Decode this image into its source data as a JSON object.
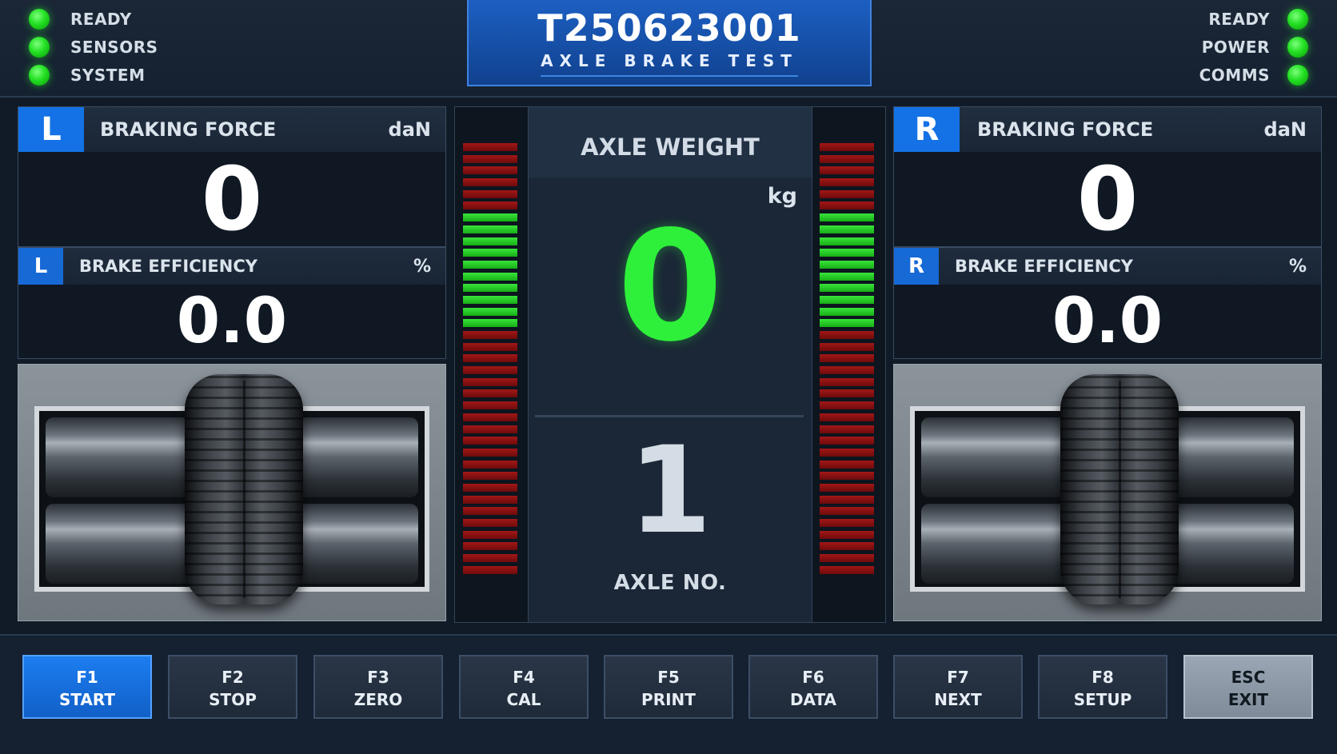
{
  "header": {
    "status_left": [
      {
        "label": "READY",
        "state": "on"
      },
      {
        "label": "SENSORS",
        "state": "on"
      },
      {
        "label": "SYSTEM",
        "state": "on"
      }
    ],
    "status_right": [
      {
        "label": "READY",
        "state": "on"
      },
      {
        "label": "POWER",
        "state": "on"
      },
      {
        "label": "COMMS",
        "state": "on"
      }
    ],
    "test_id": "T250623001",
    "test_name": "AXLE BRAKE TEST",
    "led_color": "#22e022"
  },
  "left": {
    "badge": "L",
    "force_label": "BRAKING FORCE",
    "force_unit": "daN",
    "force_value": "0",
    "efficiency_label": "BRAKE EFFICIENCY",
    "efficiency_unit": "%",
    "efficiency_value": "0.0"
  },
  "right": {
    "badge": "R",
    "force_label": "BRAKING FORCE",
    "force_unit": "daN",
    "force_value": "0",
    "efficiency_label": "BRAKE EFFICIENCY",
    "efficiency_unit": "%",
    "efficiency_value": "0.0"
  },
  "center": {
    "axle_weight_label": "AXLE WEIGHT",
    "axle_weight_unit": "kg",
    "axle_weight_value": "0",
    "axle_no_value": "1",
    "axle_no_label": "AXLE NO.",
    "bar_colors": {
      "red": "#a31717",
      "green": "#39e539",
      "accent_value": "#2ef03a"
    }
  },
  "function_keys": [
    {
      "key": "F1",
      "action": "START",
      "style": "active"
    },
    {
      "key": "F2",
      "action": "STOP",
      "style": "normal"
    },
    {
      "key": "F3",
      "action": "ZERO",
      "style": "normal"
    },
    {
      "key": "F4",
      "action": "CAL",
      "style": "normal"
    },
    {
      "key": "F5",
      "action": "PRINT",
      "style": "normal"
    },
    {
      "key": "F6",
      "action": "DATA",
      "style": "normal"
    },
    {
      "key": "F7",
      "action": "NEXT",
      "style": "normal"
    },
    {
      "key": "F8",
      "action": "SETUP",
      "style": "normal"
    },
    {
      "key": "ESC",
      "action": "EXIT",
      "style": "exit"
    }
  ],
  "colors": {
    "accent_blue": "#1472e6",
    "background": "#111b27"
  }
}
